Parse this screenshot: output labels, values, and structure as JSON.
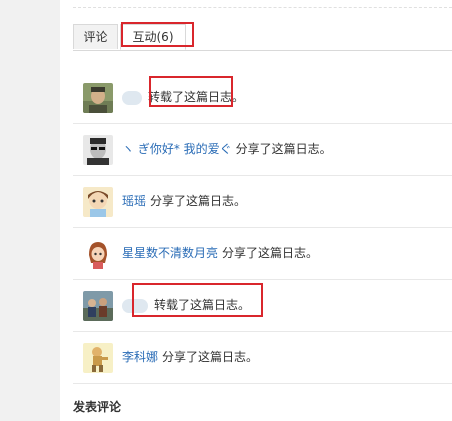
{
  "tabs": [
    {
      "label": "评论"
    },
    {
      "label": "互动(6)"
    }
  ],
  "activities": [
    {
      "user": "",
      "action": "转载了这篇日志。",
      "avatar_icon": "man-photo-avatar"
    },
    {
      "user": "ヽ ぎ你好* 我的爱ぐ",
      "action": "分享了这篇日志。",
      "avatar_icon": "glasses-man-avatar"
    },
    {
      "user": "瑶瑶",
      "action": "分享了这篇日志。",
      "avatar_icon": "cartoon-girl-avatar"
    },
    {
      "user": "星星数不清数月亮",
      "action": "分享了这篇日志。",
      "avatar_icon": "anime-girl-avatar"
    },
    {
      "user": "",
      "action": "转载了这篇日志。",
      "avatar_icon": "group-photo-avatar"
    },
    {
      "user": "李科娜",
      "action": "分享了这篇日志。",
      "avatar_icon": "cartoon-figure-avatar"
    }
  ],
  "section_title": "发表评论",
  "colors": {
    "highlight": "#d9262c",
    "link": "#2a6cb6"
  }
}
